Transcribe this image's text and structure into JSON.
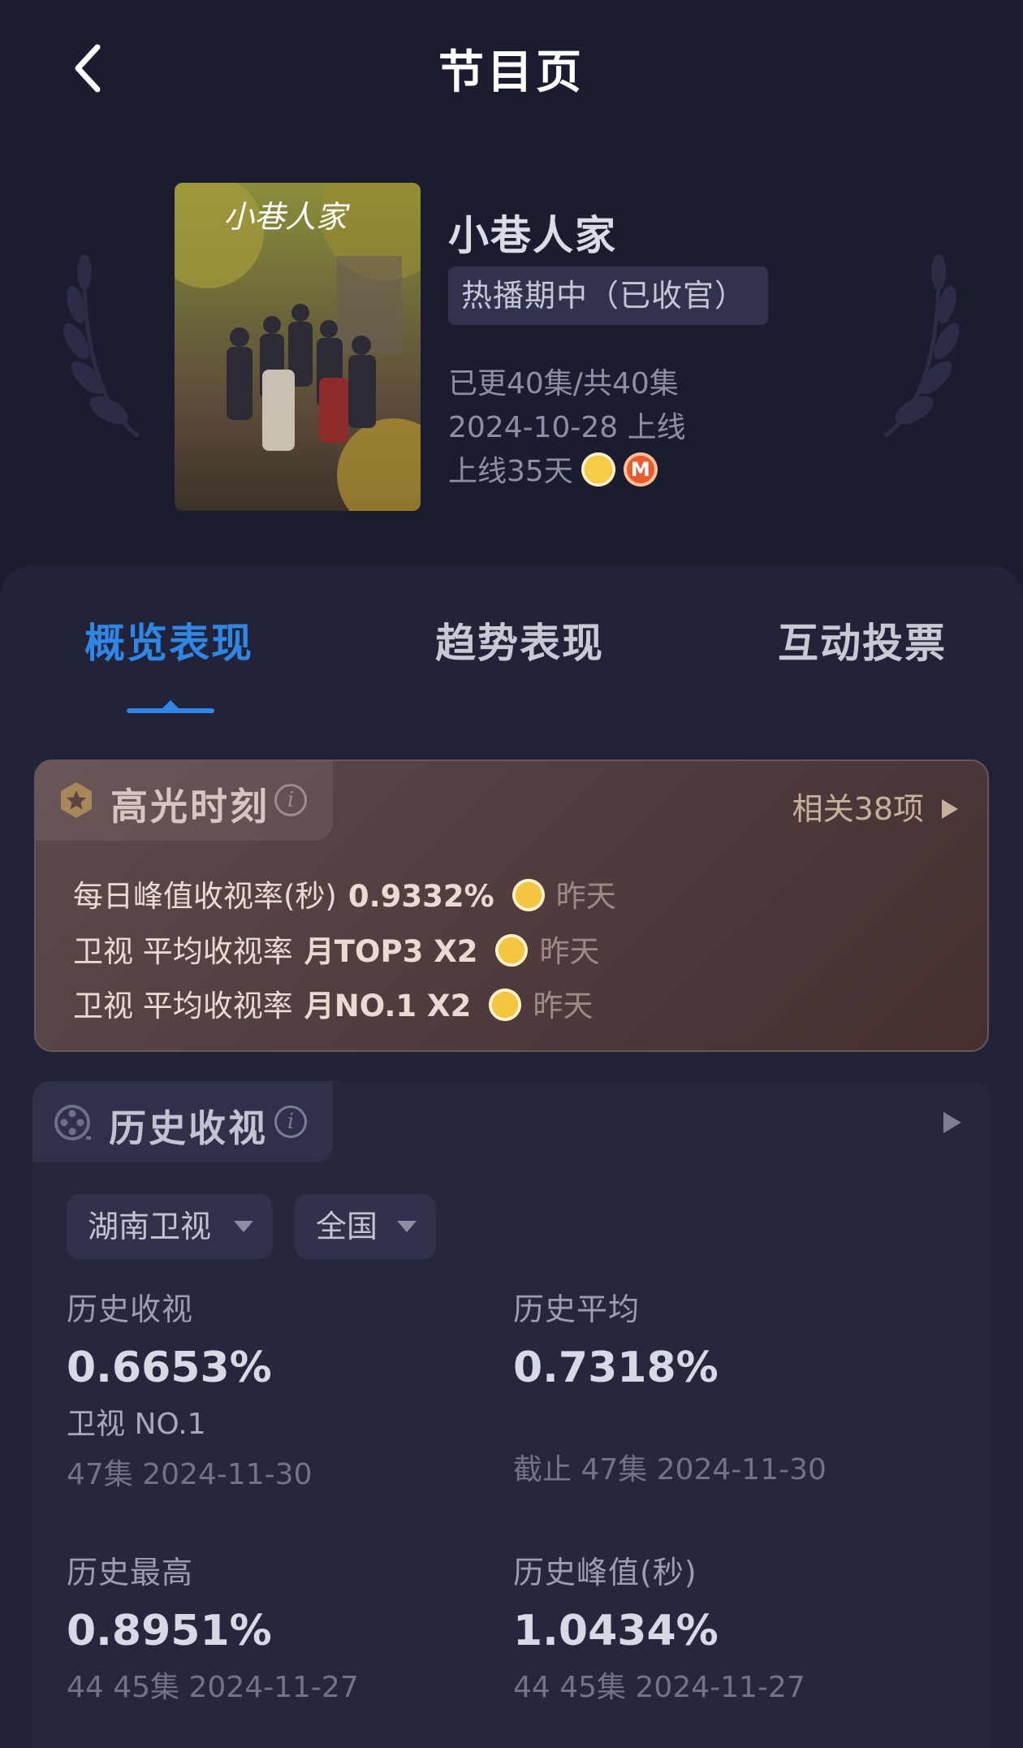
{
  "header": {
    "title": "节目页"
  },
  "show": {
    "title": "小巷人家",
    "status": "热播期中（已收官）",
    "episodes": "已更40集/共40集",
    "release": "2024-10-28 上线",
    "days_online": "上线35天",
    "poster_text": "小巷人家",
    "channel_icons": [
      "hunan-tv-icon",
      "mango-tv-icon"
    ]
  },
  "tabs": [
    {
      "label": "概览表现",
      "active": true
    },
    {
      "label": "趋势表现",
      "active": false
    },
    {
      "label": "互动投票",
      "active": false
    }
  ],
  "highlights": {
    "title": "高光时刻",
    "related": "相关38项",
    "rows": [
      {
        "label": "每日峰值收视率(秒)",
        "value": "0.9332%",
        "when": "昨天"
      },
      {
        "label": "卫视  平均收视率",
        "value": "月TOP3 X2",
        "when": "昨天"
      },
      {
        "label": "卫视  平均收视率",
        "value": "月NO.1 X2",
        "when": "昨天"
      }
    ]
  },
  "history": {
    "title": "历史收视",
    "filters": {
      "channel": "湖南卫视",
      "region": "全国"
    },
    "stats": [
      {
        "label": "历史收视",
        "value": "0.6653%",
        "rank": "卫视  NO.1",
        "sub": "47集  2024-11-30"
      },
      {
        "label": "历史平均",
        "value": "0.7318%",
        "sub": "截止 47集  2024-11-30"
      },
      {
        "label": "历史最高",
        "value": "0.8951%",
        "sub": "44 45集  2024-11-27"
      },
      {
        "label": "历史峰值(秒)",
        "value": "1.0434%",
        "sub": "44 45集  2024-11-27"
      }
    ]
  },
  "colors": {
    "background": "#1c1c30",
    "accent": "#2f86e4",
    "highlight_card": "#5e4a4c",
    "panel": "#222238"
  }
}
